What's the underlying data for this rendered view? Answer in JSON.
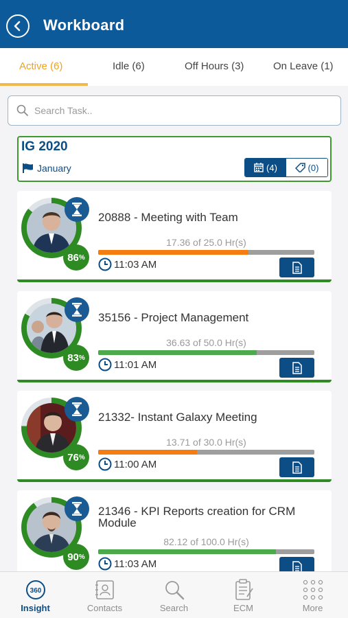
{
  "header": {
    "title": "Workboard"
  },
  "tabs": [
    {
      "label": "Active (6)"
    },
    {
      "label": "Idle (6)"
    },
    {
      "label": "Off Hours (3)"
    },
    {
      "label": "On Leave (1)"
    }
  ],
  "search": {
    "placeholder": "Search Task.."
  },
  "project": {
    "title": "IG 2020",
    "month": "January",
    "calendar_count": "(4)",
    "tag_count": "(0)"
  },
  "tasks": [
    {
      "title": "20888 - Meeting with Team",
      "hours": "17.36 of 25.0 Hr(s)",
      "progress": 0.694,
      "progress_color": "#f57c10",
      "percent": "86",
      "time": "11:03 AM"
    },
    {
      "title": "35156 - Project Management",
      "hours": "36.63 of 50.0 Hr(s)",
      "progress": 0.733,
      "progress_color": "#4caa4c",
      "percent": "83",
      "time": "11:01 AM"
    },
    {
      "title": "21332- Instant Galaxy Meeting",
      "hours": "13.71 of 30.0 Hr(s)",
      "progress": 0.457,
      "progress_color": "#f57c10",
      "percent": "76",
      "time": "11:00 AM"
    },
    {
      "title": "21346 - KPI Reports creation for CRM Module",
      "hours": "82.12 of 100.0 Hr(s)",
      "progress": 0.821,
      "progress_color": "#4caa4c",
      "percent": "90",
      "time": "11:03 AM"
    }
  ],
  "percent_symbol": "%",
  "nav": [
    {
      "label": "Insight",
      "icon": "insight-360-icon"
    },
    {
      "label": "Contacts",
      "icon": "contacts-icon"
    },
    {
      "label": "Search",
      "icon": "search-icon"
    },
    {
      "label": "ECM",
      "icon": "clipboard-icon"
    },
    {
      "label": "More",
      "icon": "more-dots-icon"
    }
  ],
  "colors": {
    "brand": "#0d5a9a",
    "accent": "#f0a21b",
    "success": "#2e8a22"
  }
}
